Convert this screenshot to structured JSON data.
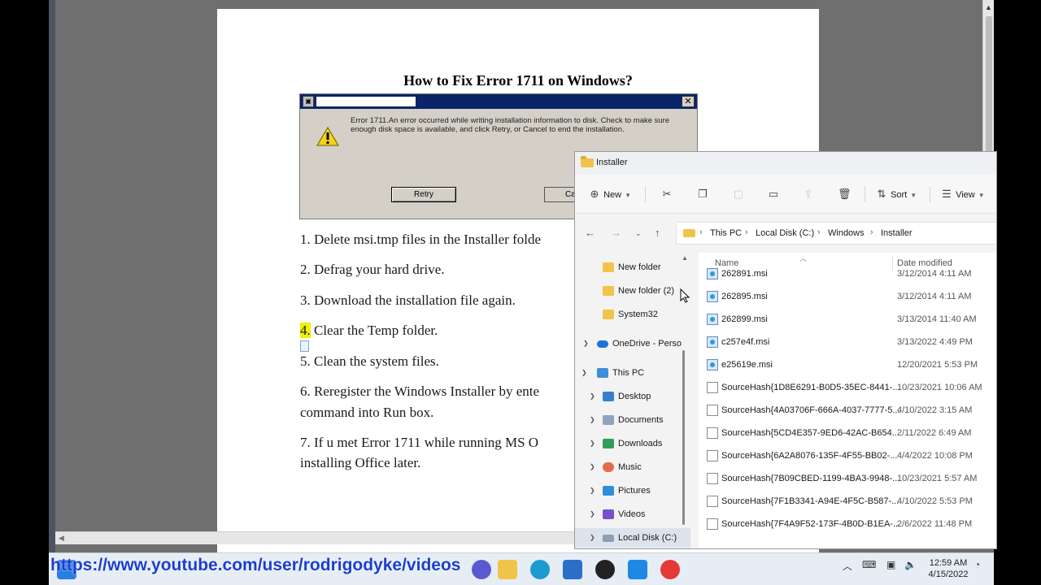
{
  "document": {
    "title": "How to Fix Error 1711 on Windows?",
    "dialog": {
      "message": "Error 1711.An error occurred while writing installation information to disk.  Check to make sure enough disk space is available, and click Retry, or Cancel to end the installation.",
      "retry_label": "Retry",
      "cancel_label": "Ca"
    },
    "steps": [
      "1. Delete msi.tmp files in the Installer folde",
      "2. Defrag your hard drive.",
      "3. Download the installation file again.",
      "4.",
      " Clear the Temp folder.",
      "5. Clean the system files.",
      "6. Reregister the Windows Installer by ente",
      "command into Run box.",
      "7. If u met Error 1711 while running MS O",
      "installing Office later."
    ]
  },
  "explorer": {
    "title": "Installer",
    "toolbar": {
      "new_label": "New",
      "sort_label": "Sort",
      "view_label": "View"
    },
    "breadcrumb": [
      "This PC",
      "Local Disk (C:)",
      "Windows",
      "Installer"
    ],
    "nav": {
      "new_folder": "New folder",
      "new_folder_2": "New folder (2)",
      "system32": "System32",
      "onedrive": "OneDrive - Perso",
      "this_pc": "This PC",
      "desktop": "Desktop",
      "documents": "Documents",
      "downloads": "Downloads",
      "music": "Music",
      "pictures": "Pictures",
      "videos": "Videos",
      "local_disk": "Local Disk (C:)"
    },
    "columns": {
      "name": "Name",
      "date": "Date modified"
    },
    "files": [
      {
        "name": "262891.msi",
        "date": "3/12/2014 4:11 AM",
        "type": "msi"
      },
      {
        "name": "262895.msi",
        "date": "3/12/2014 4:11 AM",
        "type": "msi"
      },
      {
        "name": "262899.msi",
        "date": "3/13/2014 11:40 AM",
        "type": "msi"
      },
      {
        "name": "c257e4f.msi",
        "date": "3/13/2022 4:49 PM",
        "type": "msi"
      },
      {
        "name": "e25619e.msi",
        "date": "12/20/2021 5:53 PM",
        "type": "msi"
      },
      {
        "name": "SourceHash{1D8E6291-B0D5-35EC-8441-...",
        "date": "10/23/2021 10:06 AM",
        "type": "doc"
      },
      {
        "name": "SourceHash{4A03706F-666A-4037-7777-5...",
        "date": "4/10/2022 3:15 AM",
        "type": "doc"
      },
      {
        "name": "SourceHash{5CD4E357-9ED6-42AC-B654...",
        "date": "2/11/2022 6:49 AM",
        "type": "doc"
      },
      {
        "name": "SourceHash{6A2A8076-135F-4F55-BB02-...",
        "date": "4/4/2022 10:08 PM",
        "type": "doc"
      },
      {
        "name": "SourceHash{7B09CBED-1199-4BA3-9948-...",
        "date": "10/23/2021 5:57 AM",
        "type": "doc"
      },
      {
        "name": "SourceHash{7F1B3341-A94E-4F5C-B587-...",
        "date": "4/10/2022 5:53 PM",
        "type": "doc"
      },
      {
        "name": "SourceHash{7F4A9F52-173F-4B0D-B1EA-...",
        "date": "2/6/2022 11:48 PM",
        "type": "doc"
      }
    ]
  },
  "overlay": {
    "link": "https://www.youtube.com/user/rodrigodyke/videos"
  },
  "taskbar": {
    "time": "12:59 AM",
    "date": "4/15/2022"
  },
  "colors": {
    "accent": "#0067c0",
    "folder": "#f1c34a",
    "dialog_title": "#0a246a",
    "highlight": "#f0f000",
    "link": "#1a3fd0"
  }
}
